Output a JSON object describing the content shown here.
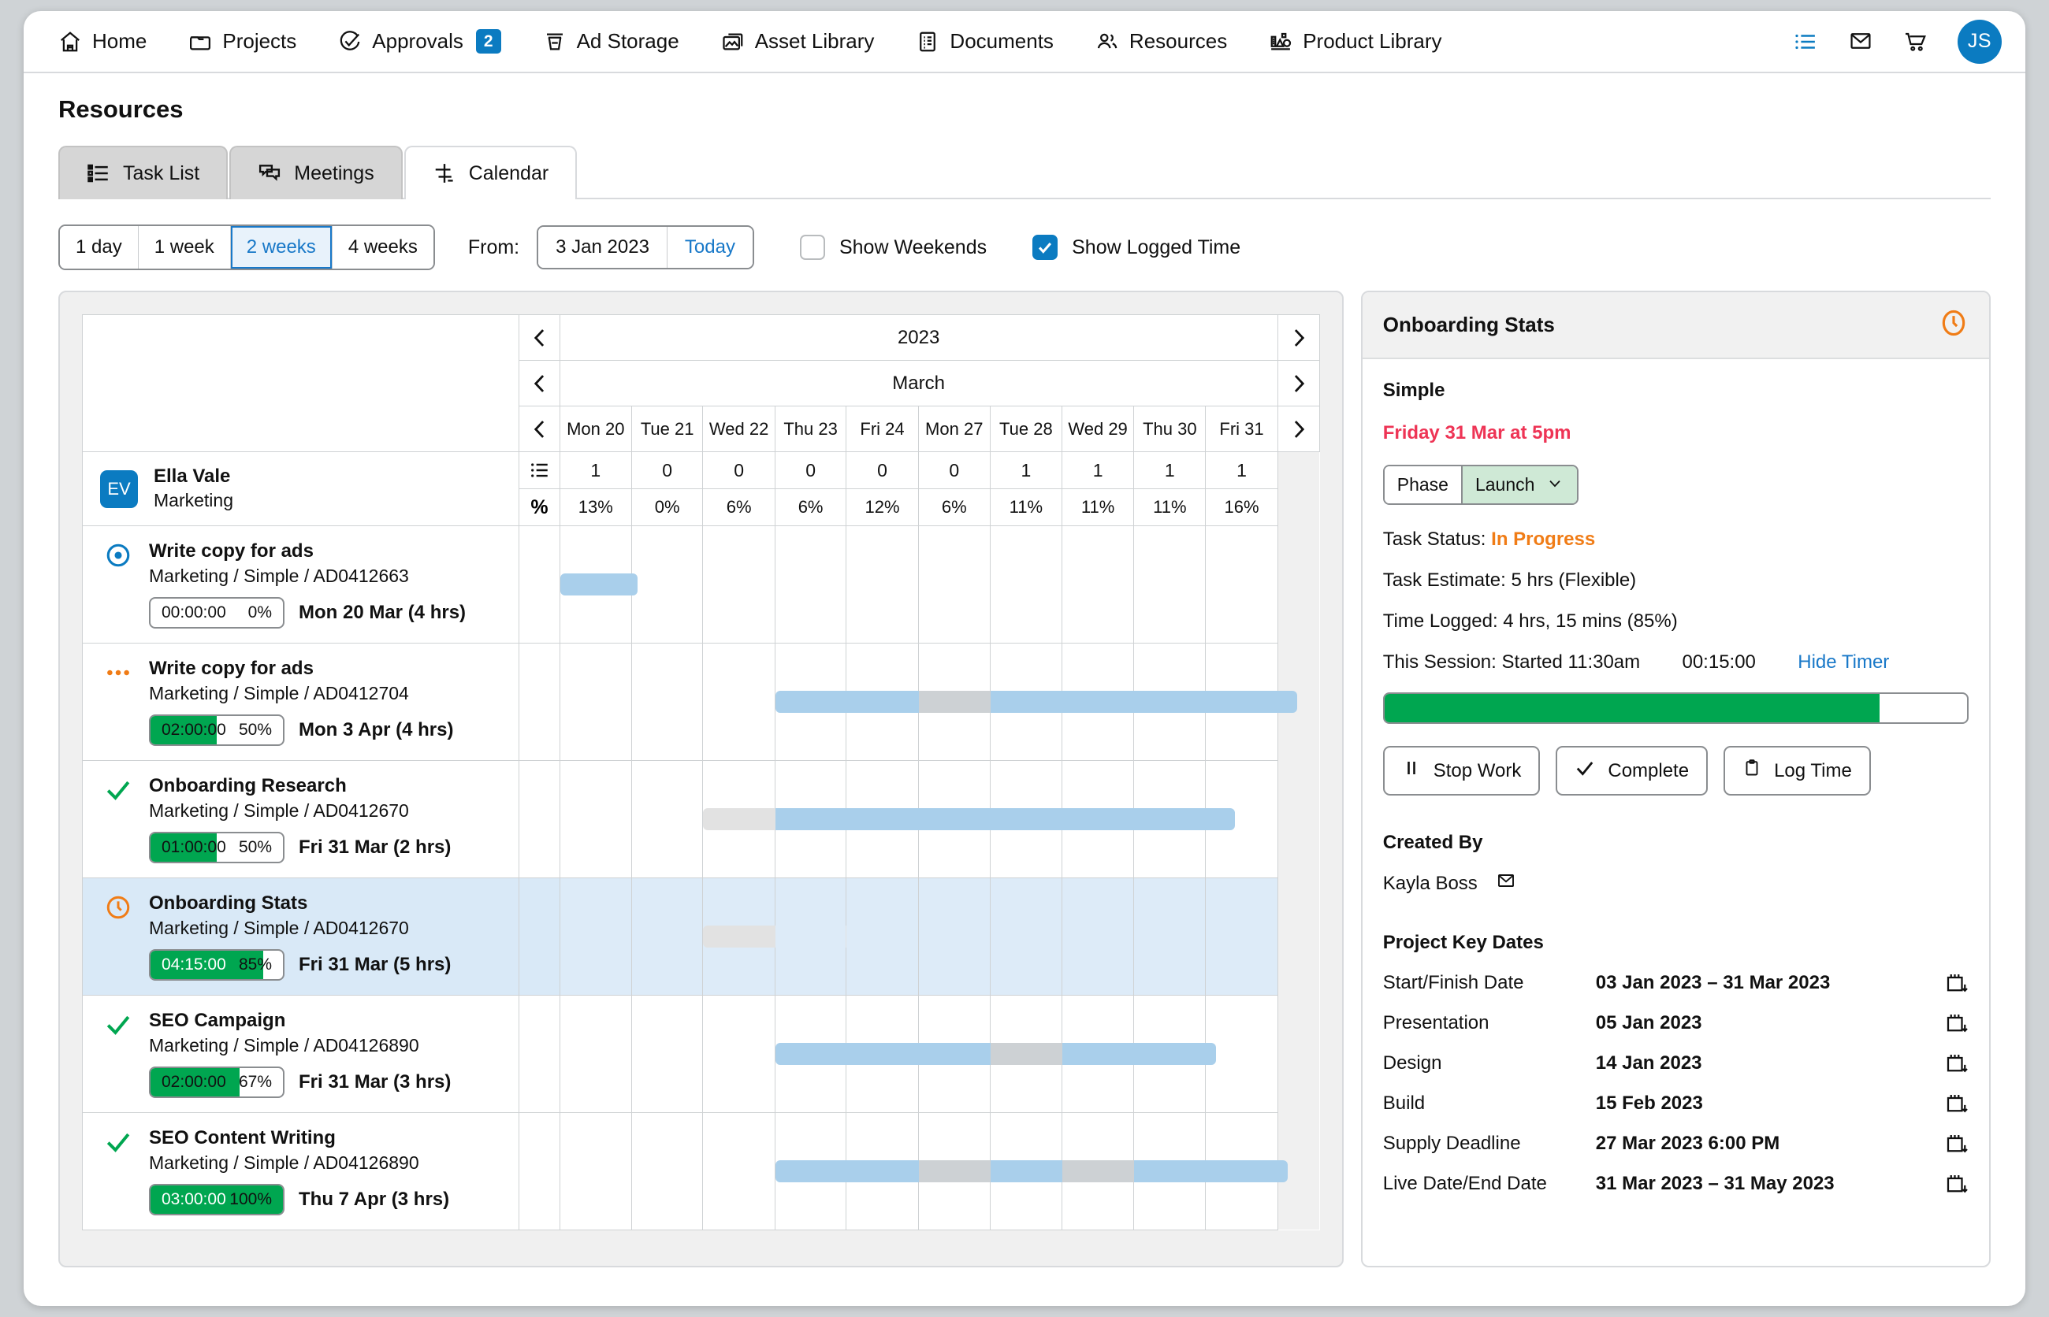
{
  "nav": {
    "items": [
      {
        "label": "Home",
        "icon": "home-icon"
      },
      {
        "label": "Projects",
        "icon": "folder-icon"
      },
      {
        "label": "Approvals",
        "icon": "check-circle-icon",
        "badge": "2"
      },
      {
        "label": "Ad Storage",
        "icon": "ad-storage-icon"
      },
      {
        "label": "Asset Library",
        "icon": "images-icon"
      },
      {
        "label": "Documents",
        "icon": "document-icon"
      },
      {
        "label": "Resources",
        "icon": "people-icon"
      },
      {
        "label": "Product Library",
        "icon": "product-library-icon"
      }
    ],
    "right": {
      "list_icon": "list-icon",
      "mail_icon": "mail-icon",
      "cart_icon": "cart-icon",
      "avatar_initials": "JS"
    }
  },
  "page": {
    "title": "Resources"
  },
  "tabs": [
    {
      "label": "Task List",
      "icon": "task-list-icon",
      "active": false
    },
    {
      "label": "Meetings",
      "icon": "meetings-icon",
      "active": false
    },
    {
      "label": "Calendar",
      "icon": "calendar-gantt-icon",
      "active": true
    }
  ],
  "toolbar": {
    "ranges": [
      "1 day",
      "1 week",
      "2 weeks",
      "4 weeks"
    ],
    "selected_range": "2 weeks",
    "from_label": "From:",
    "from_value": "3 Jan 2023",
    "today_label": "Today",
    "show_weekends": {
      "label": "Show Weekends",
      "checked": false
    },
    "show_logged_time": {
      "label": "Show Logged Time",
      "checked": true
    }
  },
  "gantt": {
    "year": "2023",
    "month": "March",
    "days": [
      "Mon 20",
      "Tue 21",
      "Wed 22",
      "Thu 23",
      "Fri 24",
      "Mon 27",
      "Tue 28",
      "Wed 29",
      "Thu 30",
      "Fri 31"
    ],
    "counts": [
      "1",
      "0",
      "0",
      "0",
      "0",
      "0",
      "1",
      "1",
      "1",
      "1"
    ],
    "percents": [
      "13%",
      "0%",
      "6%",
      "6%",
      "12%",
      "6%",
      "11%",
      "11%",
      "11%",
      "16%"
    ],
    "count_row_icon": "list-icon",
    "percent_row_symbol": "%",
    "person": {
      "initials": "EV",
      "name": "Ella Vale",
      "role": "Marketing"
    },
    "tasks": [
      {
        "status_icon": "radio-target-icon",
        "title": "Write copy for ads",
        "path": "Marketing / Simple / AD0412663",
        "time": "00:00:00",
        "percent": "0%",
        "fill": 0,
        "due": "Mon 20 Mar (4 hrs)",
        "selected": false,
        "segments": [
          {
            "start": 0,
            "span": 1,
            "type": "blue"
          }
        ]
      },
      {
        "status_icon": "dots-icon",
        "title": "Write copy for ads",
        "path": "Marketing / Simple / AD0412704",
        "time": "02:00:00",
        "percent": "50%",
        "fill": 50,
        "due": "Mon 3 Apr (4 hrs)",
        "selected": false,
        "segments": [
          {
            "start": 3,
            "span": 2,
            "type": "blue"
          },
          {
            "start": 5,
            "span": 1,
            "type": "grey"
          },
          {
            "start": 6,
            "span": 4,
            "type": "blue"
          }
        ]
      },
      {
        "status_icon": "check-icon",
        "title": "Onboarding Research",
        "path": "Marketing / Simple / AD0412670",
        "time": "01:00:00",
        "percent": "50%",
        "fill": 50,
        "due": "Fri 31 Mar (2 hrs)",
        "selected": false,
        "segments": [
          {
            "start": 2,
            "span": 1,
            "type": "greylight"
          },
          {
            "start": 3,
            "span": 6,
            "type": "blue"
          }
        ]
      },
      {
        "status_icon": "clock-icon",
        "title": "Onboarding Stats",
        "path": "Marketing / Simple / AD0412670",
        "time": "04:15:00",
        "percent": "85%",
        "fill": 85,
        "due": "Fri 31 Mar (5 hrs)",
        "selected": true,
        "segments": [
          {
            "start": 2,
            "span": 2,
            "type": "greylight"
          }
        ]
      },
      {
        "status_icon": "check-icon",
        "title": "SEO Campaign",
        "path": "Marketing / Simple / AD04126890",
        "time": "02:00:00",
        "percent": "67%",
        "fill": 67,
        "due": "Fri 31 Mar (3 hrs)",
        "selected": false,
        "segments": [
          {
            "start": 3,
            "span": 3,
            "type": "blue"
          },
          {
            "start": 6,
            "span": 1,
            "type": "grey"
          },
          {
            "start": 7,
            "span": 2,
            "type": "blue"
          }
        ]
      },
      {
        "status_icon": "check-icon",
        "title": "SEO Content Writing",
        "path": "Marketing / Simple / AD04126890",
        "time": "03:00:00",
        "percent": "100%",
        "fill": 100,
        "due": "Thu 7 Apr (3 hrs)",
        "selected": false,
        "segments": [
          {
            "start": 3,
            "span": 2,
            "type": "blue"
          },
          {
            "start": 5,
            "span": 1,
            "type": "grey"
          },
          {
            "start": 6,
            "span": 1,
            "type": "blue"
          },
          {
            "start": 7,
            "span": 1,
            "type": "grey"
          },
          {
            "start": 8,
            "span": 2,
            "type": "blue"
          }
        ]
      }
    ]
  },
  "panel": {
    "title": "Onboarding Stats",
    "header_icon": "clock-icon",
    "subtitle": "Simple",
    "due": "Friday 31 Mar at 5pm",
    "phase": {
      "key": "Phase",
      "value": "Launch"
    },
    "task_status_label": "Task Status:",
    "task_status_value": "In Progress",
    "task_estimate": "Task Estimate: 5 hrs (Flexible)",
    "time_logged": "Time Logged: 4 hrs, 15 mins   (85%)",
    "session_label": "This Session: Started 11:30am",
    "session_timer": "00:15:00",
    "hide_timer": "Hide Timer",
    "progress_percent": 85,
    "buttons": [
      {
        "label": "Stop Work",
        "icon": "pause-icon"
      },
      {
        "label": "Complete",
        "icon": "check-icon"
      },
      {
        "label": "Log Time",
        "icon": "clipboard-icon"
      }
    ],
    "created_by_heading": "Created By",
    "created_by_name": "Kayla Boss",
    "created_by_icon": "mail-icon",
    "key_dates_heading": "Project Key Dates",
    "key_dates": [
      {
        "label": "Start/Finish Date",
        "value": "03 Jan 2023 – 31 Mar 2023",
        "icon": "calendar-icon"
      },
      {
        "label": "Presentation",
        "value": "05 Jan 2023",
        "icon": "calendar-icon"
      },
      {
        "label": "Design",
        "value": "14 Jan 2023",
        "icon": "calendar-icon"
      },
      {
        "label": "Build",
        "value": "15 Feb 2023",
        "icon": "calendar-icon"
      },
      {
        "label": "Supply Deadline",
        "value": "27 Mar 2023 6:00 PM",
        "icon": "calendar-icon"
      },
      {
        "label": "Live Date/End Date",
        "value": "31 Mar 2023 – 31 May 2023",
        "icon": "calendar-icon"
      }
    ]
  },
  "colors": {
    "accent": "#0b7bc1",
    "green": "#00a650",
    "orange": "#f07c16",
    "red": "#ee3455",
    "bar_blue": "#a9cfeb",
    "bar_grey": "#cdd1d4"
  }
}
